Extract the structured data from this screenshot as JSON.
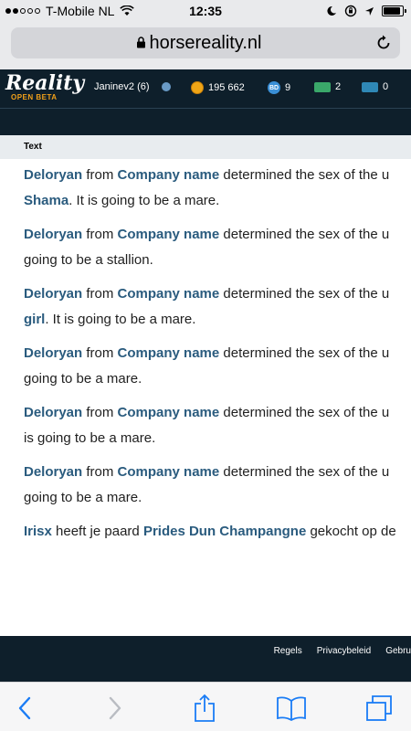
{
  "status_bar": {
    "carrier": "T-Mobile NL",
    "time": "12:35",
    "battery_level": 0.9
  },
  "browser": {
    "url": "horsereality.nl"
  },
  "site_header": {
    "logo_main": "Reality",
    "logo_sub": "OPEN BETA",
    "username": "Janinev2 (6)",
    "coins": "195 662",
    "bd_count": "9",
    "ticket_green_count": "2",
    "ticket_blue_count": "0"
  },
  "content": {
    "section_label": "Text",
    "feed": [
      {
        "user": "Deloryan",
        "from": " from ",
        "company": "Company name",
        "text1": " determined the sex of the u",
        "horse": "Shama",
        "text2": ". It is going to be a mare."
      },
      {
        "user": "Deloryan",
        "from": " from ",
        "company": "Company name",
        "text1": " determined the sex of the u",
        "horse": "",
        "text2": "going to be a stallion."
      },
      {
        "user": "Deloryan",
        "from": " from ",
        "company": "Company name",
        "text1": " determined the sex of the u",
        "horse": "girl",
        "text2": ". It is going to be a mare."
      },
      {
        "user": "Deloryan",
        "from": " from ",
        "company": "Company name",
        "text1": " determined the sex of the u",
        "horse": "",
        "text2": "going to be a mare."
      },
      {
        "user": "Deloryan",
        "from": " from ",
        "company": "Company name",
        "text1": " determined the sex of the u",
        "horse": "",
        "text2": "is going to be a mare."
      },
      {
        "user": "Deloryan",
        "from": " from ",
        "company": "Company name",
        "text1": " determined the sex of the u",
        "horse": "",
        "text2": "going to be a mare."
      }
    ],
    "last_item": {
      "user": "Irisx",
      "text1": " heeft je paard ",
      "horse": "Prides Dun Champangne",
      "text2": " gekocht op de"
    }
  },
  "footer": {
    "links": [
      "Regels",
      "Privacybeleid",
      "Gebru"
    ]
  },
  "toolbar": {
    "icons": [
      "back-icon",
      "forward-icon",
      "share-icon",
      "bookmarks-icon",
      "tabs-icon"
    ]
  },
  "colors": {
    "header_bg": "#0e1f2b",
    "link": "#2a5b7e",
    "accent_orange": "#f2a11a",
    "ios_blue": "#1a7cf5"
  }
}
